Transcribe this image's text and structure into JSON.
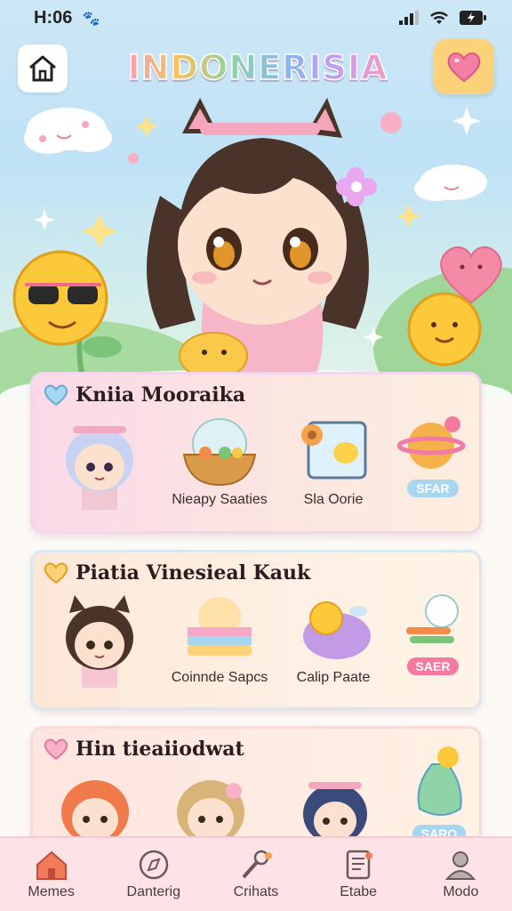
{
  "status_bar": {
    "time": "H:06",
    "paw": "🐾"
  },
  "header": {
    "title": "INDONERISIA"
  },
  "cards": [
    {
      "title": "Kniia Mooraika",
      "items": [
        {
          "label": ""
        },
        {
          "label": "Nieapy Saaties"
        },
        {
          "label": "Sla Oorie"
        },
        {
          "label": "SFAR"
        }
      ]
    },
    {
      "title": "Piatia Vinesieal Kauk",
      "items": [
        {
          "label": ""
        },
        {
          "label": "Coinnde Sapcs"
        },
        {
          "label": "Calip Paate"
        },
        {
          "label": "SAER"
        }
      ]
    },
    {
      "title": "Hin tieaiiodwat",
      "items": [
        {
          "label": ""
        },
        {
          "label": ""
        },
        {
          "label": ""
        },
        {
          "label": "SARO"
        }
      ]
    }
  ],
  "bottom_nav": [
    {
      "label": "Memes",
      "icon": "home-icon",
      "active": true
    },
    {
      "label": "Danterig",
      "icon": "compass-icon"
    },
    {
      "label": "Crihats",
      "icon": "tools-icon"
    },
    {
      "label": "Etabe",
      "icon": "list-icon"
    },
    {
      "label": "Modo",
      "icon": "profile-icon"
    }
  ],
  "colors": {
    "accent_pink": "#f59dbb",
    "accent_yellow": "#fbd27a",
    "nav_bg": "#fde2e6"
  }
}
